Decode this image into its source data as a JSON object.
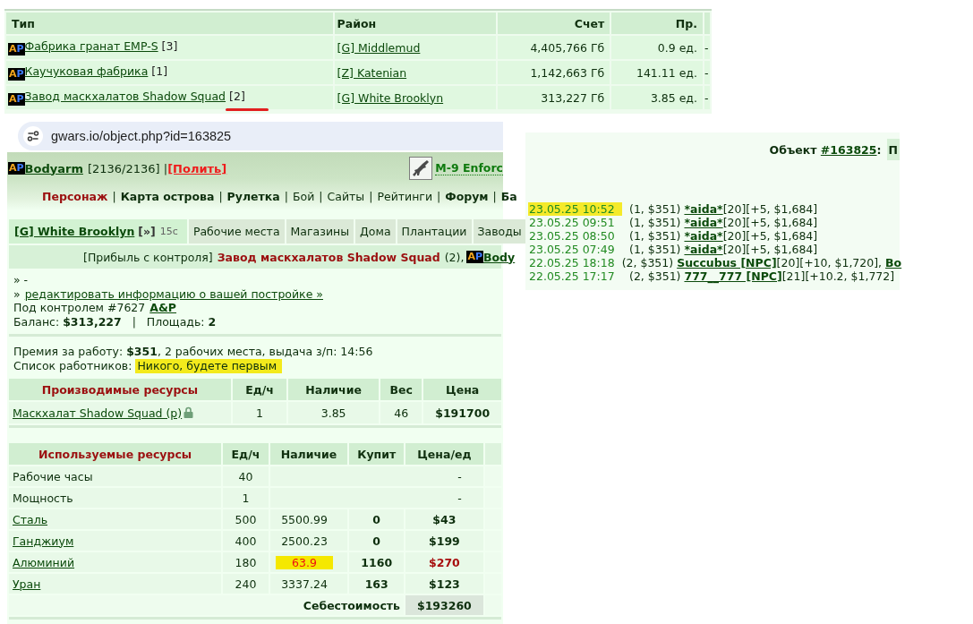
{
  "buildings_table": {
    "columns": [
      "Тип",
      "Район",
      "Счет",
      "Пр."
    ],
    "rows": [
      {
        "clan_logo": "AP",
        "name": "Фабрика гранат EMP-S",
        "count": "[3]",
        "district": "[G] Middlemud",
        "account": "4,405,766 Гб",
        "output": "0.9 ед.",
        "column_5": "-",
        "marked": false
      },
      {
        "clan_logo": "AP",
        "name": "Каучуковая фабрика",
        "count": "[1]",
        "district": "[Z] Katenian",
        "account": "1,142,663 Гб",
        "output": "141.11 ед.",
        "column_5": "-",
        "marked": false
      },
      {
        "clan_logo": "AP",
        "name": "Завод маскхалатов Shadow Squad",
        "count": "[2]",
        "district": "[G] White Brooklyn",
        "account": "313,227 Гб",
        "output": "3.85 ед.",
        "column_5": "-",
        "marked": true
      }
    ]
  },
  "browser": {
    "address": "gwars.io/object.php?id=163825"
  },
  "header": {
    "clan_logo": "AP",
    "player": "Bodyarm",
    "health": "[2136/2136] |",
    "action": "[Полить]",
    "weapon": "M-9 Enforc"
  },
  "nav": {
    "separator": "|",
    "items": [
      {
        "label": "Персонаж",
        "kind": "current"
      },
      {
        "label": "Карта острова",
        "kind": "bold"
      },
      {
        "label": "Рулетка",
        "kind": "bold"
      },
      {
        "label": "Бой",
        "kind": "plain"
      },
      {
        "label": "Сайты",
        "kind": "plain"
      },
      {
        "label": "Рейтинги",
        "kind": "plain"
      },
      {
        "label": "Форум",
        "kind": "bold"
      },
      {
        "label": "Ба",
        "kind": "bold"
      }
    ]
  },
  "district_bar": {
    "district": "[G] White Brooklyn",
    "more": "[»]",
    "timer": "15с",
    "tabs": [
      {
        "label": "Рабочие места",
        "selected": false
      },
      {
        "label": "Магазины",
        "selected": false
      },
      {
        "label": "Дома",
        "selected": false
      },
      {
        "label": "Плантации",
        "selected": false
      },
      {
        "label": "Заводы",
        "selected": false
      }
    ]
  },
  "profit_bar": {
    "label": "[Прибыль с контроля]",
    "building": "Завод маскхалатов Shadow Squad",
    "count": "(2),",
    "clan_logo": "AP",
    "owner": "Body"
  },
  "info": {
    "description": "» -",
    "edit_prefix": "»",
    "edit_link": "редактировать информацию о вашей постройке »",
    "control": "Под контролем #7627",
    "control_link": "A&P",
    "balance": "Баланс: **$313,227**   |   Площадь: **2**"
  },
  "workers": {
    "wage": "Премия за работу: **$351**, 2 рабочих места, выдача з/п: 14:56",
    "list_label": "Список работников:",
    "list_value": "Никого, будете первым",
    "highlighted": true
  },
  "produced": {
    "columns": [
      "Производимые ресурсы",
      "Ед/ч",
      "Наличие",
      "Вес",
      "Цена"
    ],
    "rows": [
      {
        "name": "Маскхалат Shadow Squad (р)",
        "locked": true,
        "per_hour": "1",
        "stock": "3.85",
        "weight": "46",
        "price": "$191700"
      }
    ]
  },
  "used": {
    "columns": [
      "Используемые ресурсы",
      "Ед/ч",
      "Наличие",
      "Купит",
      "Цена/ед"
    ],
    "rows": [
      {
        "name": "Рабочие часы",
        "kind": "plain",
        "per_hour": "40",
        "price": "-",
        "short": false
      },
      {
        "name": "Мощность",
        "kind": "plain",
        "per_hour": "1",
        "price": "-",
        "short": false
      },
      {
        "name": "Сталь",
        "kind": "link",
        "per_hour": "500",
        "stock": "5500.99",
        "buy": "0",
        "price": "$43",
        "short": false
      },
      {
        "name": "Ганджиум",
        "kind": "link",
        "per_hour": "400",
        "stock": "2500.23",
        "buy": "0",
        "price": "$199",
        "short": false
      },
      {
        "name": "Алюминий",
        "kind": "link",
        "per_hour": "180",
        "stock": "63.9",
        "buy": "1160",
        "price": "$270",
        "short": true
      },
      {
        "name": "Уран",
        "kind": "link",
        "per_hour": "240",
        "stock": "3337.24",
        "buy": "163",
        "price": "$123",
        "short": false
      }
    ],
    "total_label": "Себестоимость",
    "total": "$193260"
  },
  "object_log": {
    "label": "Объект",
    "object_link": "#163825",
    "suffix": ":",
    "tab_stub": "П",
    "entries": [
      {
        "time": "23.05.25 10:52",
        "highlighted": true,
        "summary": "(1, $351)",
        "parts": [
          {
            "kind": "link",
            "text": "*aida*"
          },
          {
            "kind": "text",
            "text": "[20][+5, $1,684]"
          }
        ]
      },
      {
        "time": "23.05.25 09:51",
        "highlighted": false,
        "summary": "(1, $351)",
        "parts": [
          {
            "kind": "link",
            "text": "*aida*"
          },
          {
            "kind": "text",
            "text": "[20][+5, $1,684]"
          }
        ]
      },
      {
        "time": "23.05.25 08:50",
        "highlighted": false,
        "summary": "(1, $351)",
        "parts": [
          {
            "kind": "link",
            "text": "*aida*"
          },
          {
            "kind": "text",
            "text": "[20][+5, $1,684]"
          }
        ]
      },
      {
        "time": "23.05.25 07:49",
        "highlighted": false,
        "summary": "(1, $351)",
        "parts": [
          {
            "kind": "link",
            "text": "*aida*"
          },
          {
            "kind": "text",
            "text": "[20][+5, $1,684]"
          }
        ]
      },
      {
        "time": "22.05.25 18:18",
        "highlighted": false,
        "summary": "(2, $351)",
        "parts": [
          {
            "kind": "link",
            "text": "Succubus [NPC]"
          },
          {
            "kind": "text",
            "text": "[20][+10, $1,720],"
          },
          {
            "kind": "link",
            "text": "Bo"
          }
        ]
      },
      {
        "time": "22.05.25 17:17",
        "highlighted": false,
        "summary": "(2, $351)",
        "parts": [
          {
            "kind": "link",
            "text": "777__777 [NPC]"
          },
          {
            "kind": "text",
            "text": "[21][+10.2, $1,772]"
          }
        ]
      }
    ]
  }
}
